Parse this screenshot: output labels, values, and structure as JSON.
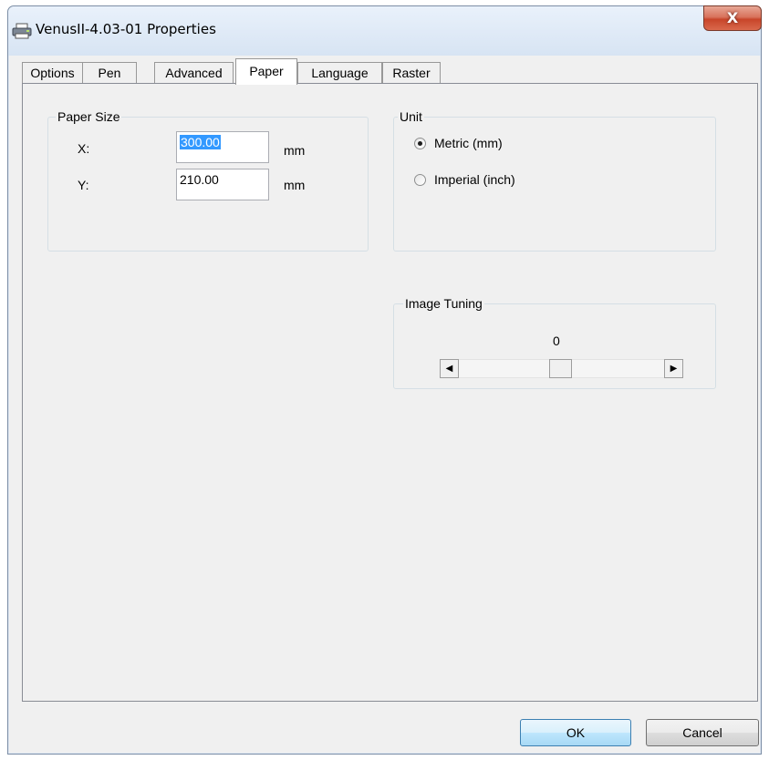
{
  "window": {
    "title": "VenusII-4.03-01 Properties",
    "close_label": "X"
  },
  "tabs": [
    {
      "label": "Options",
      "active": false
    },
    {
      "label": "Pen",
      "active": false
    },
    {
      "label": "Advanced",
      "active": false
    },
    {
      "label": "Paper",
      "active": true
    },
    {
      "label": "Language",
      "active": false
    },
    {
      "label": "Raster",
      "active": false
    }
  ],
  "paper_size": {
    "label": "Paper Size",
    "x_label": "X:",
    "x_value": "300.00",
    "x_unit": "mm",
    "y_label": "Y:",
    "y_value": "210.00",
    "y_unit": "mm"
  },
  "unit": {
    "label": "Unit",
    "options": [
      {
        "label": "Metric (mm)",
        "checked": true
      },
      {
        "label": "Imperial (inch)",
        "checked": false
      }
    ]
  },
  "image_tuning": {
    "label": "Image Tuning",
    "value": "0",
    "slider_fraction": 0.5
  },
  "buttons": {
    "ok": "OK",
    "cancel": "Cancel"
  }
}
